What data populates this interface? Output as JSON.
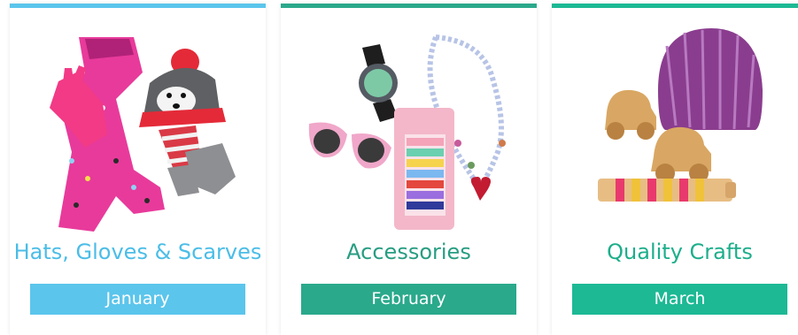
{
  "cards": [
    {
      "title": "Hats, Gloves & Scarves",
      "month": "January",
      "accent": "#5bc5ec",
      "title_color": "#4bbde7",
      "button_color": "#5bc5ec",
      "image": "hat-gloves-scarf-image"
    },
    {
      "title": "Accessories",
      "month": "February",
      "accent": "#2aa98b",
      "title_color": "#279d82",
      "button_color": "#2aa98b",
      "image": "accessories-image"
    },
    {
      "title": "Quality Crafts",
      "month": "March",
      "accent": "#1cb994",
      "title_color": "#1cae8b",
      "button_color": "#1cb994",
      "image": "crafts-image"
    }
  ]
}
